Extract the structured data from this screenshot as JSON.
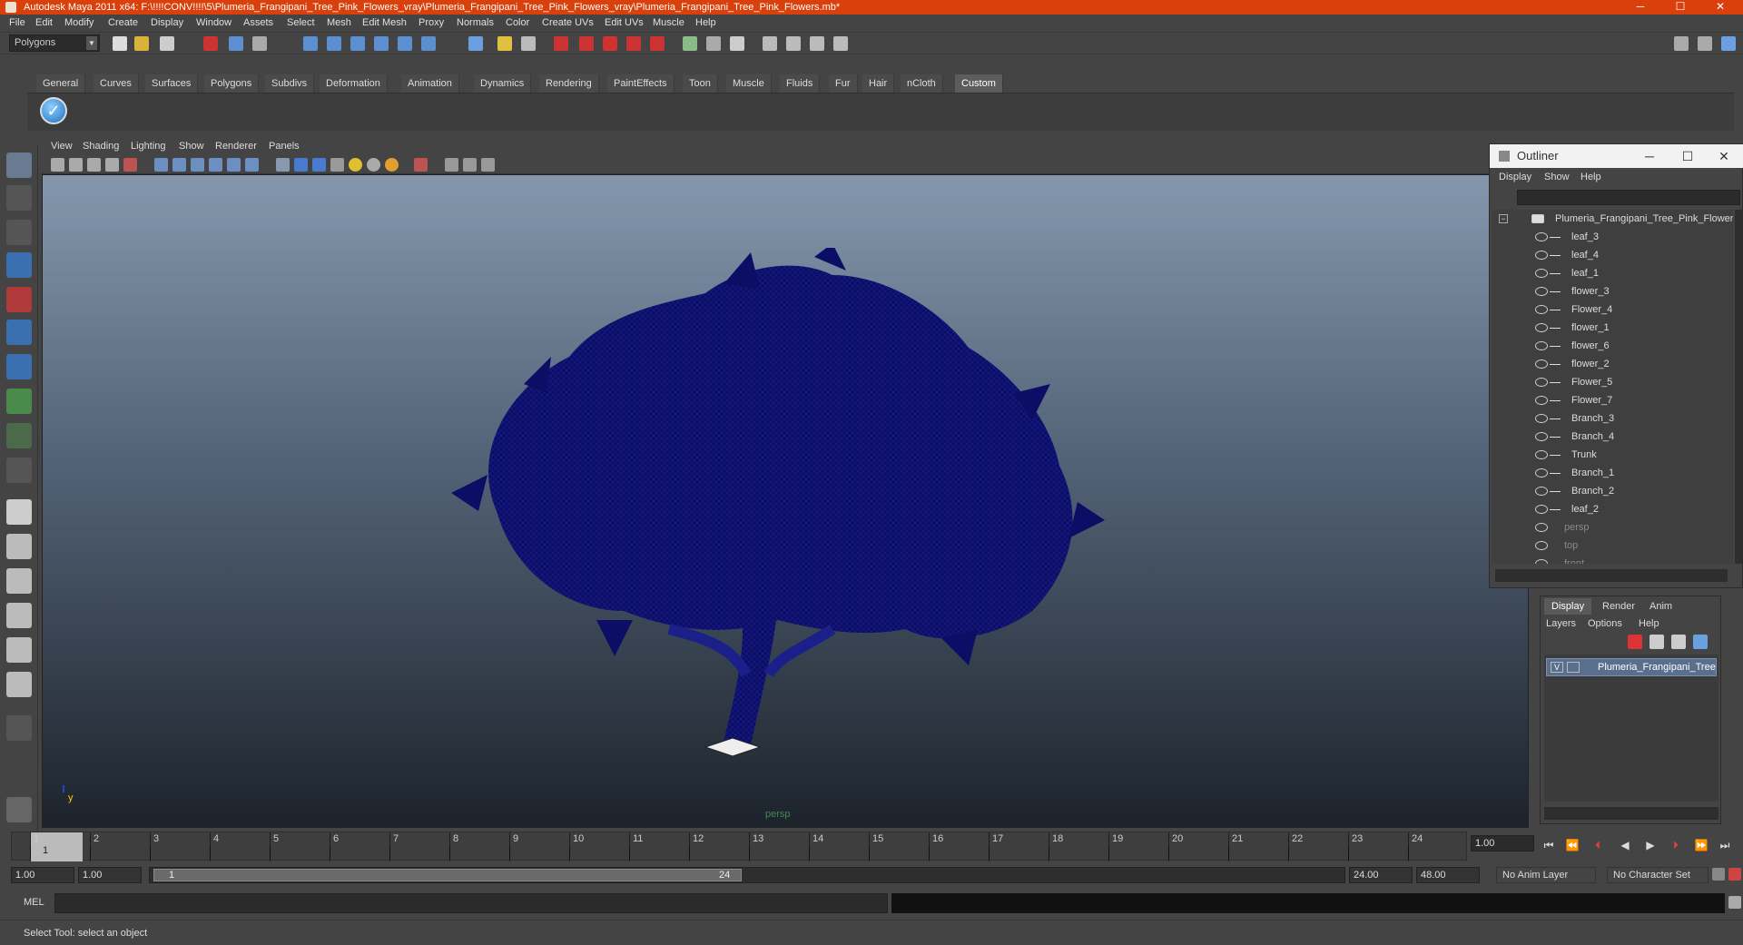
{
  "title": "Autodesk Maya 2011 x64: F:\\!!!!CONV!!!!\\5\\Plumeria_Frangipani_Tree_Pink_Flowers_vray\\Plumeria_Frangipani_Tree_Pink_Flowers_vray\\Plumeria_Frangipani_Tree_Pink_Flowers.mb*",
  "menubar": [
    "File",
    "Edit",
    "Modify",
    "Create",
    "Display",
    "Window",
    "Assets",
    "Select",
    "Mesh",
    "Edit Mesh",
    "Proxy",
    "Normals",
    "Color",
    "Create UVs",
    "Edit UVs",
    "Muscle",
    "Help"
  ],
  "mode": "Polygons",
  "shelf_tabs": [
    "General",
    "Curves",
    "Surfaces",
    "Polygons",
    "Subdivs",
    "Deformation",
    "Animation",
    "Dynamics",
    "Rendering",
    "PaintEffects",
    "Toon",
    "Muscle",
    "Fluids",
    "Fur",
    "Hair",
    "nCloth",
    "Custom"
  ],
  "active_shelf": "Custom",
  "viewport_menu": [
    "View",
    "Shading",
    "Lighting",
    "Show",
    "Renderer",
    "Panels"
  ],
  "viewport": {
    "camera_label": "persp",
    "axis_y": "y",
    "wire_color": "#0d0f6e"
  },
  "outliner": {
    "title": "Outliner",
    "menu": [
      "Display",
      "Show",
      "Help"
    ],
    "root": "Plumeria_Frangipani_Tree_Pink_Flowers",
    "items": [
      "leaf_3",
      "leaf_4",
      "leaf_1",
      "flower_3",
      "Flower_4",
      "flower_1",
      "flower_6",
      "flower_2",
      "Flower_5",
      "Flower_7",
      "Branch_3",
      "Branch_4",
      "Trunk",
      "Branch_1",
      "Branch_2",
      "leaf_2"
    ],
    "cameras": [
      "persp",
      "top",
      "front"
    ]
  },
  "layers": {
    "tabs": [
      "Display",
      "Render",
      "Anim"
    ],
    "menu": [
      "Layers",
      "Options",
      "Help"
    ],
    "layer_visible": "V",
    "layer_name": "Plumeria_Frangipani_Tree_Pink_Flowers"
  },
  "timeline": {
    "ticks": [
      "1",
      "2",
      "3",
      "4",
      "5",
      "6",
      "7",
      "8",
      "9",
      "10",
      "11",
      "12",
      "13",
      "14",
      "15",
      "16",
      "17",
      "18",
      "19",
      "20",
      "21",
      "22",
      "23",
      "24"
    ],
    "current": "1",
    "current_time": "1.00"
  },
  "range": {
    "start_time": "1.00",
    "playback_start": "1.00",
    "handle_start": "1",
    "handle_end": "24",
    "playback_end": "24.00",
    "end_time": "48.00",
    "anim_layer": "No Anim Layer",
    "character_set": "No Character Set"
  },
  "command": {
    "label": "MEL"
  },
  "help_line": "Select Tool: select an object"
}
